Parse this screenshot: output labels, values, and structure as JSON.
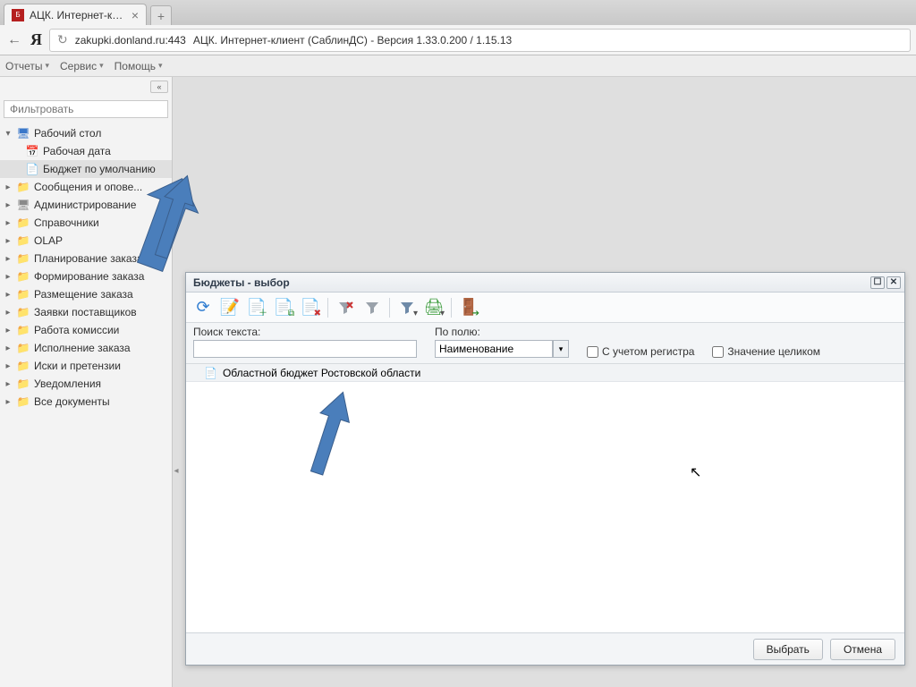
{
  "browser": {
    "tab_title": "АЦК. Интернет-клиен",
    "url_host": "zakupki.donland.ru:443",
    "page_title": "АЦК. Интернет-клиент (СаблинДС) - Версия 1.33.0.200 / 1.15.13"
  },
  "menubar": {
    "reports": "Отчеты",
    "service": "Сервис",
    "help": "Помощь"
  },
  "sidebar": {
    "filter_placeholder": "Фильтровать",
    "desktop": "Рабочий стол",
    "work_date": "Рабочая дата",
    "default_budget": "Бюджет по умолчанию",
    "messages": "Сообщения и опове...",
    "admin": "Администрирование",
    "refs": "Справочники",
    "olap": "OLAP",
    "plan": "Планирование заказа",
    "form": "Формирование заказа",
    "place": "Размещение заказа",
    "supplier": "Заявки поставщиков",
    "commission": "Работа комиссии",
    "exec": "Исполнение заказа",
    "claims": "Иски и претензии",
    "notif": "Уведомления",
    "alldocs": "Все документы"
  },
  "dialog": {
    "title": "Бюджеты - выбор",
    "search_label": "Поиск текста:",
    "field_label": "По полю:",
    "field_value": "Наименование",
    "cb_case": "С учетом регистра",
    "cb_whole": "Значение целиком",
    "row1": "Областной бюджет Ростовской области",
    "btn_select": "Выбрать",
    "btn_cancel": "Отмена"
  }
}
